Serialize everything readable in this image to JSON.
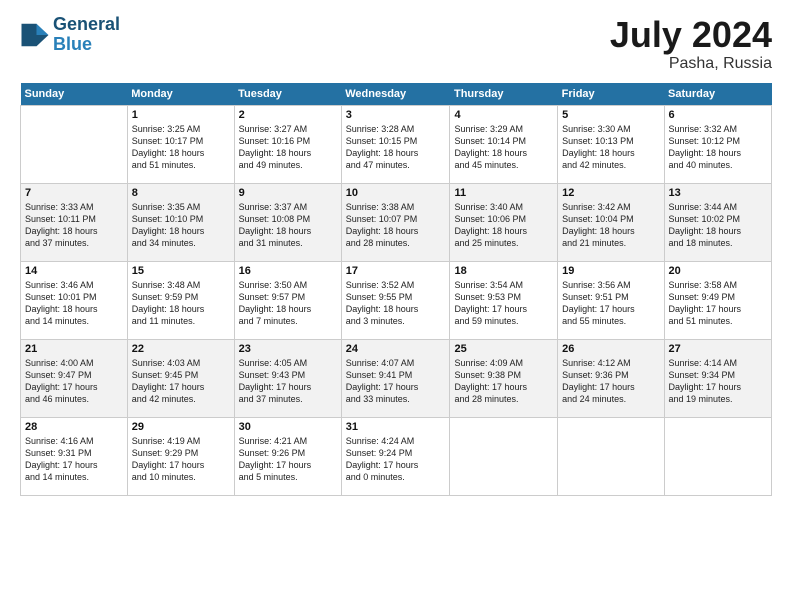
{
  "header": {
    "logo_line1": "General",
    "logo_line2": "Blue",
    "month_year": "July 2024",
    "location": "Pasha, Russia"
  },
  "weekdays": [
    "Sunday",
    "Monday",
    "Tuesday",
    "Wednesday",
    "Thursday",
    "Friday",
    "Saturday"
  ],
  "weeks": [
    [
      {
        "day": "",
        "info": ""
      },
      {
        "day": "1",
        "info": "Sunrise: 3:25 AM\nSunset: 10:17 PM\nDaylight: 18 hours\nand 51 minutes."
      },
      {
        "day": "2",
        "info": "Sunrise: 3:27 AM\nSunset: 10:16 PM\nDaylight: 18 hours\nand 49 minutes."
      },
      {
        "day": "3",
        "info": "Sunrise: 3:28 AM\nSunset: 10:15 PM\nDaylight: 18 hours\nand 47 minutes."
      },
      {
        "day": "4",
        "info": "Sunrise: 3:29 AM\nSunset: 10:14 PM\nDaylight: 18 hours\nand 45 minutes."
      },
      {
        "day": "5",
        "info": "Sunrise: 3:30 AM\nSunset: 10:13 PM\nDaylight: 18 hours\nand 42 minutes."
      },
      {
        "day": "6",
        "info": "Sunrise: 3:32 AM\nSunset: 10:12 PM\nDaylight: 18 hours\nand 40 minutes."
      }
    ],
    [
      {
        "day": "7",
        "info": "Sunrise: 3:33 AM\nSunset: 10:11 PM\nDaylight: 18 hours\nand 37 minutes."
      },
      {
        "day": "8",
        "info": "Sunrise: 3:35 AM\nSunset: 10:10 PM\nDaylight: 18 hours\nand 34 minutes."
      },
      {
        "day": "9",
        "info": "Sunrise: 3:37 AM\nSunset: 10:08 PM\nDaylight: 18 hours\nand 31 minutes."
      },
      {
        "day": "10",
        "info": "Sunrise: 3:38 AM\nSunset: 10:07 PM\nDaylight: 18 hours\nand 28 minutes."
      },
      {
        "day": "11",
        "info": "Sunrise: 3:40 AM\nSunset: 10:06 PM\nDaylight: 18 hours\nand 25 minutes."
      },
      {
        "day": "12",
        "info": "Sunrise: 3:42 AM\nSunset: 10:04 PM\nDaylight: 18 hours\nand 21 minutes."
      },
      {
        "day": "13",
        "info": "Sunrise: 3:44 AM\nSunset: 10:02 PM\nDaylight: 18 hours\nand 18 minutes."
      }
    ],
    [
      {
        "day": "14",
        "info": "Sunrise: 3:46 AM\nSunset: 10:01 PM\nDaylight: 18 hours\nand 14 minutes."
      },
      {
        "day": "15",
        "info": "Sunrise: 3:48 AM\nSunset: 9:59 PM\nDaylight: 18 hours\nand 11 minutes."
      },
      {
        "day": "16",
        "info": "Sunrise: 3:50 AM\nSunset: 9:57 PM\nDaylight: 18 hours\nand 7 minutes."
      },
      {
        "day": "17",
        "info": "Sunrise: 3:52 AM\nSunset: 9:55 PM\nDaylight: 18 hours\nand 3 minutes."
      },
      {
        "day": "18",
        "info": "Sunrise: 3:54 AM\nSunset: 9:53 PM\nDaylight: 17 hours\nand 59 minutes."
      },
      {
        "day": "19",
        "info": "Sunrise: 3:56 AM\nSunset: 9:51 PM\nDaylight: 17 hours\nand 55 minutes."
      },
      {
        "day": "20",
        "info": "Sunrise: 3:58 AM\nSunset: 9:49 PM\nDaylight: 17 hours\nand 51 minutes."
      }
    ],
    [
      {
        "day": "21",
        "info": "Sunrise: 4:00 AM\nSunset: 9:47 PM\nDaylight: 17 hours\nand 46 minutes."
      },
      {
        "day": "22",
        "info": "Sunrise: 4:03 AM\nSunset: 9:45 PM\nDaylight: 17 hours\nand 42 minutes."
      },
      {
        "day": "23",
        "info": "Sunrise: 4:05 AM\nSunset: 9:43 PM\nDaylight: 17 hours\nand 37 minutes."
      },
      {
        "day": "24",
        "info": "Sunrise: 4:07 AM\nSunset: 9:41 PM\nDaylight: 17 hours\nand 33 minutes."
      },
      {
        "day": "25",
        "info": "Sunrise: 4:09 AM\nSunset: 9:38 PM\nDaylight: 17 hours\nand 28 minutes."
      },
      {
        "day": "26",
        "info": "Sunrise: 4:12 AM\nSunset: 9:36 PM\nDaylight: 17 hours\nand 24 minutes."
      },
      {
        "day": "27",
        "info": "Sunrise: 4:14 AM\nSunset: 9:34 PM\nDaylight: 17 hours\nand 19 minutes."
      }
    ],
    [
      {
        "day": "28",
        "info": "Sunrise: 4:16 AM\nSunset: 9:31 PM\nDaylight: 17 hours\nand 14 minutes."
      },
      {
        "day": "29",
        "info": "Sunrise: 4:19 AM\nSunset: 9:29 PM\nDaylight: 17 hours\nand 10 minutes."
      },
      {
        "day": "30",
        "info": "Sunrise: 4:21 AM\nSunset: 9:26 PM\nDaylight: 17 hours\nand 5 minutes."
      },
      {
        "day": "31",
        "info": "Sunrise: 4:24 AM\nSunset: 9:24 PM\nDaylight: 17 hours\nand 0 minutes."
      },
      {
        "day": "",
        "info": ""
      },
      {
        "day": "",
        "info": ""
      },
      {
        "day": "",
        "info": ""
      }
    ]
  ]
}
